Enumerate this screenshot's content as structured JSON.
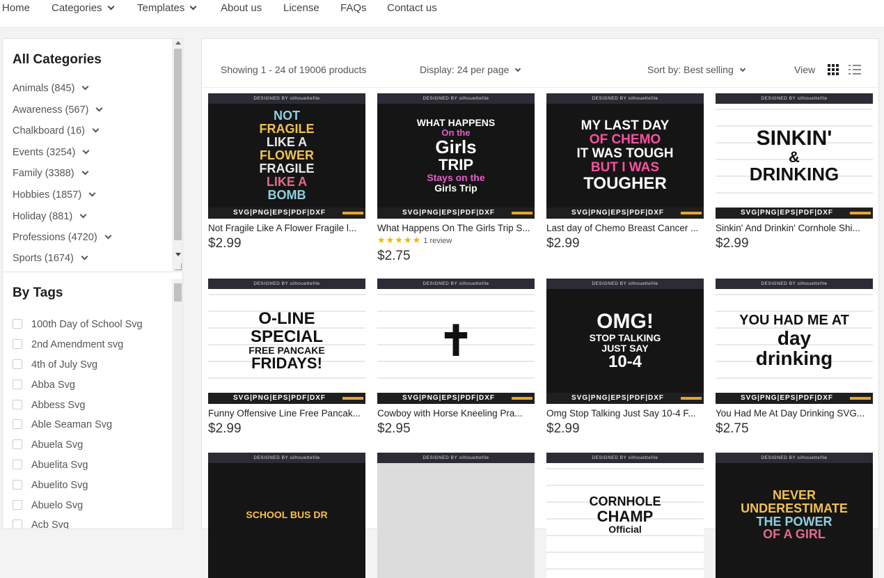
{
  "nav": {
    "items": [
      {
        "label": "Home",
        "dropdown": false
      },
      {
        "label": "Categories",
        "dropdown": true
      },
      {
        "label": "Templates",
        "dropdown": true
      },
      {
        "label": "About us",
        "dropdown": false
      },
      {
        "label": "License",
        "dropdown": false
      },
      {
        "label": "FAQs",
        "dropdown": false
      },
      {
        "label": "Contact us",
        "dropdown": false
      }
    ]
  },
  "sidebar": {
    "categories_title": "All Categories",
    "categories": [
      "Animals (845)",
      "Awareness (567)",
      "Chalkboard (16)",
      "Events (3254)",
      "Family (3388)",
      "Hobbies (1857)",
      "Holiday (881)",
      "Professions (4720)",
      "Sports (1674)"
    ],
    "tags_title": "By Tags",
    "tags": [
      "100th Day of School Svg",
      "2nd Amendment svg",
      "4th of July Svg",
      "Abba Svg",
      "Abbess Svg",
      "Able Seaman Svg",
      "Abuela Svg",
      "Abuelita Svg",
      "Abuelito Svg",
      "Abuelo Svg",
      "Acb Svg"
    ]
  },
  "toolbar": {
    "showing": "Showing 1 - 24 of 19006 products",
    "display": "Display: 24 per page",
    "sort": "Sort by: Best selling",
    "view_label": "View"
  },
  "thumb_brand": "DESIGNED BY silhouettefile",
  "thumb_formats": "SVG|PNG|EPS|PDF|DXF",
  "products": [
    {
      "name": "Not Fragile Like A Flower Fragile l...",
      "price": "$2.99",
      "design": [
        "NOT",
        "FRAGILE",
        "LIKE A",
        "FLOWER",
        "FRAGILE",
        "LIKE A",
        "BOMB"
      ],
      "bg": "dark",
      "colors": [
        "#8fd0e0",
        "#f2c14e",
        "#e9e9e9",
        "#f2c14e",
        "#e9e9e9",
        "#e36b8a",
        "#8fd0e0"
      ]
    },
    {
      "name": "What Happens On The Girls Trip S...",
      "price": null,
      "rating_text": "1 review",
      "stars": 5,
      "price_with_rating": "$2.75",
      "design": [
        "WHAT HAPPENS",
        "On the",
        "Girls",
        "TRIP",
        "Stays on the",
        "Girls Trip"
      ],
      "bg": "dark",
      "colors": [
        "#ffffff",
        "#e060c8",
        "#ffffff",
        "#ffffff",
        "#e060c8",
        "#ffffff"
      ]
    },
    {
      "name": "Last day of Chemo Breast Cancer ...",
      "price": "$2.99",
      "design": [
        "MY LAST DAY",
        "OF CHEMO",
        "IT WAS TOUGH",
        "BUT I WAS",
        "TOUGHER"
      ],
      "bg": "dark",
      "colors": [
        "#ffffff",
        "#ff4fa0",
        "#ffffff",
        "#ff4fa0",
        "#ffffff"
      ]
    },
    {
      "name": "Sinkin' And Drinkin' Cornhole Shi...",
      "price": "$2.99",
      "design": [
        "SINKIN'",
        "&",
        "DRINKING"
      ],
      "bg": "light",
      "colors": [
        "#111111",
        "#111111",
        "#111111"
      ]
    },
    {
      "name": "Funny Offensive Line Free Pancak...",
      "price": "$2.99",
      "design": [
        "O-LINE",
        "SPECIAL",
        "FREE PANCAKE",
        "FRIDAYS!"
      ],
      "bg": "light",
      "colors": [
        "#111111",
        "#111111",
        "#111111",
        "#111111"
      ]
    },
    {
      "name": "Cowboy with Horse Kneeling Pra...",
      "price": "$2.95",
      "design": [
        "✝"
      ],
      "bg": "light",
      "colors": [
        "#111111"
      ]
    },
    {
      "name": "Omg Stop Talking Just Say 10-4 F...",
      "price": "$2.99",
      "design": [
        "OMG!",
        "STOP TALKING",
        "JUST SAY",
        "10-4"
      ],
      "bg": "dark",
      "colors": [
        "#ffffff",
        "#ffffff",
        "#ffffff",
        "#ffffff"
      ]
    },
    {
      "name": "You Had Me At Day Drinking SVG...",
      "price": "$2.75",
      "design": [
        "YOU HAD ME AT",
        "day",
        "drinking"
      ],
      "bg": "light",
      "colors": [
        "#111111",
        "#111111",
        "#111111"
      ]
    },
    {
      "name": "",
      "price": "",
      "design": [
        "SCHOOL BUS DR"
      ],
      "bg": "dark",
      "colors": [
        "#f2c14e"
      ]
    },
    {
      "name": "",
      "price": "",
      "design": [],
      "bg": "grey",
      "colors": []
    },
    {
      "name": "",
      "price": "",
      "design": [
        "CORNHOLE",
        "CHAMP",
        "Official"
      ],
      "bg": "light",
      "colors": [
        "#111111",
        "#111111",
        "#111111"
      ]
    },
    {
      "name": "",
      "price": "",
      "design": [
        "NEVER",
        "UNDERESTIMATE",
        "THE POWER",
        "OF A GIRL"
      ],
      "bg": "dark",
      "colors": [
        "#f2c14e",
        "#f2c14e",
        "#8fd0e0",
        "#e36b8a"
      ]
    }
  ]
}
